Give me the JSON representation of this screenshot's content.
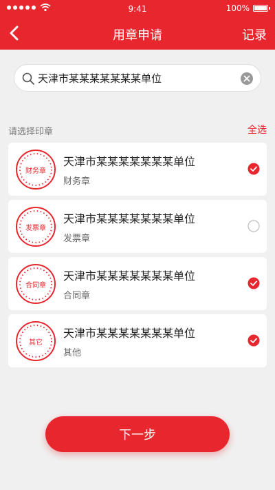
{
  "status_bar": {
    "time": "9:41",
    "battery": "100%"
  },
  "nav": {
    "title": "用章申请",
    "right_label": "记录"
  },
  "search": {
    "value": "天津市某某某某某某某单位",
    "placeholder": ""
  },
  "list": {
    "title": "请选择印章",
    "select_all": "全选",
    "items": [
      {
        "name": "天津市某某某某某某某单位",
        "type": "财务章",
        "seal_text": "财务章",
        "checked": true
      },
      {
        "name": "天津市某某某某某某某单位",
        "type": "发票章",
        "seal_text": "发票章",
        "checked": false
      },
      {
        "name": "天津市某某某某某某某单位",
        "type": "合同章",
        "seal_text": "合同章",
        "checked": true
      },
      {
        "name": "天津市某某某某某某某单位",
        "type": "其他",
        "seal_text": "其它",
        "checked": true
      }
    ]
  },
  "next_button": "下一步",
  "colors": {
    "accent": "#e8262d",
    "background": "#f0f0f0"
  }
}
